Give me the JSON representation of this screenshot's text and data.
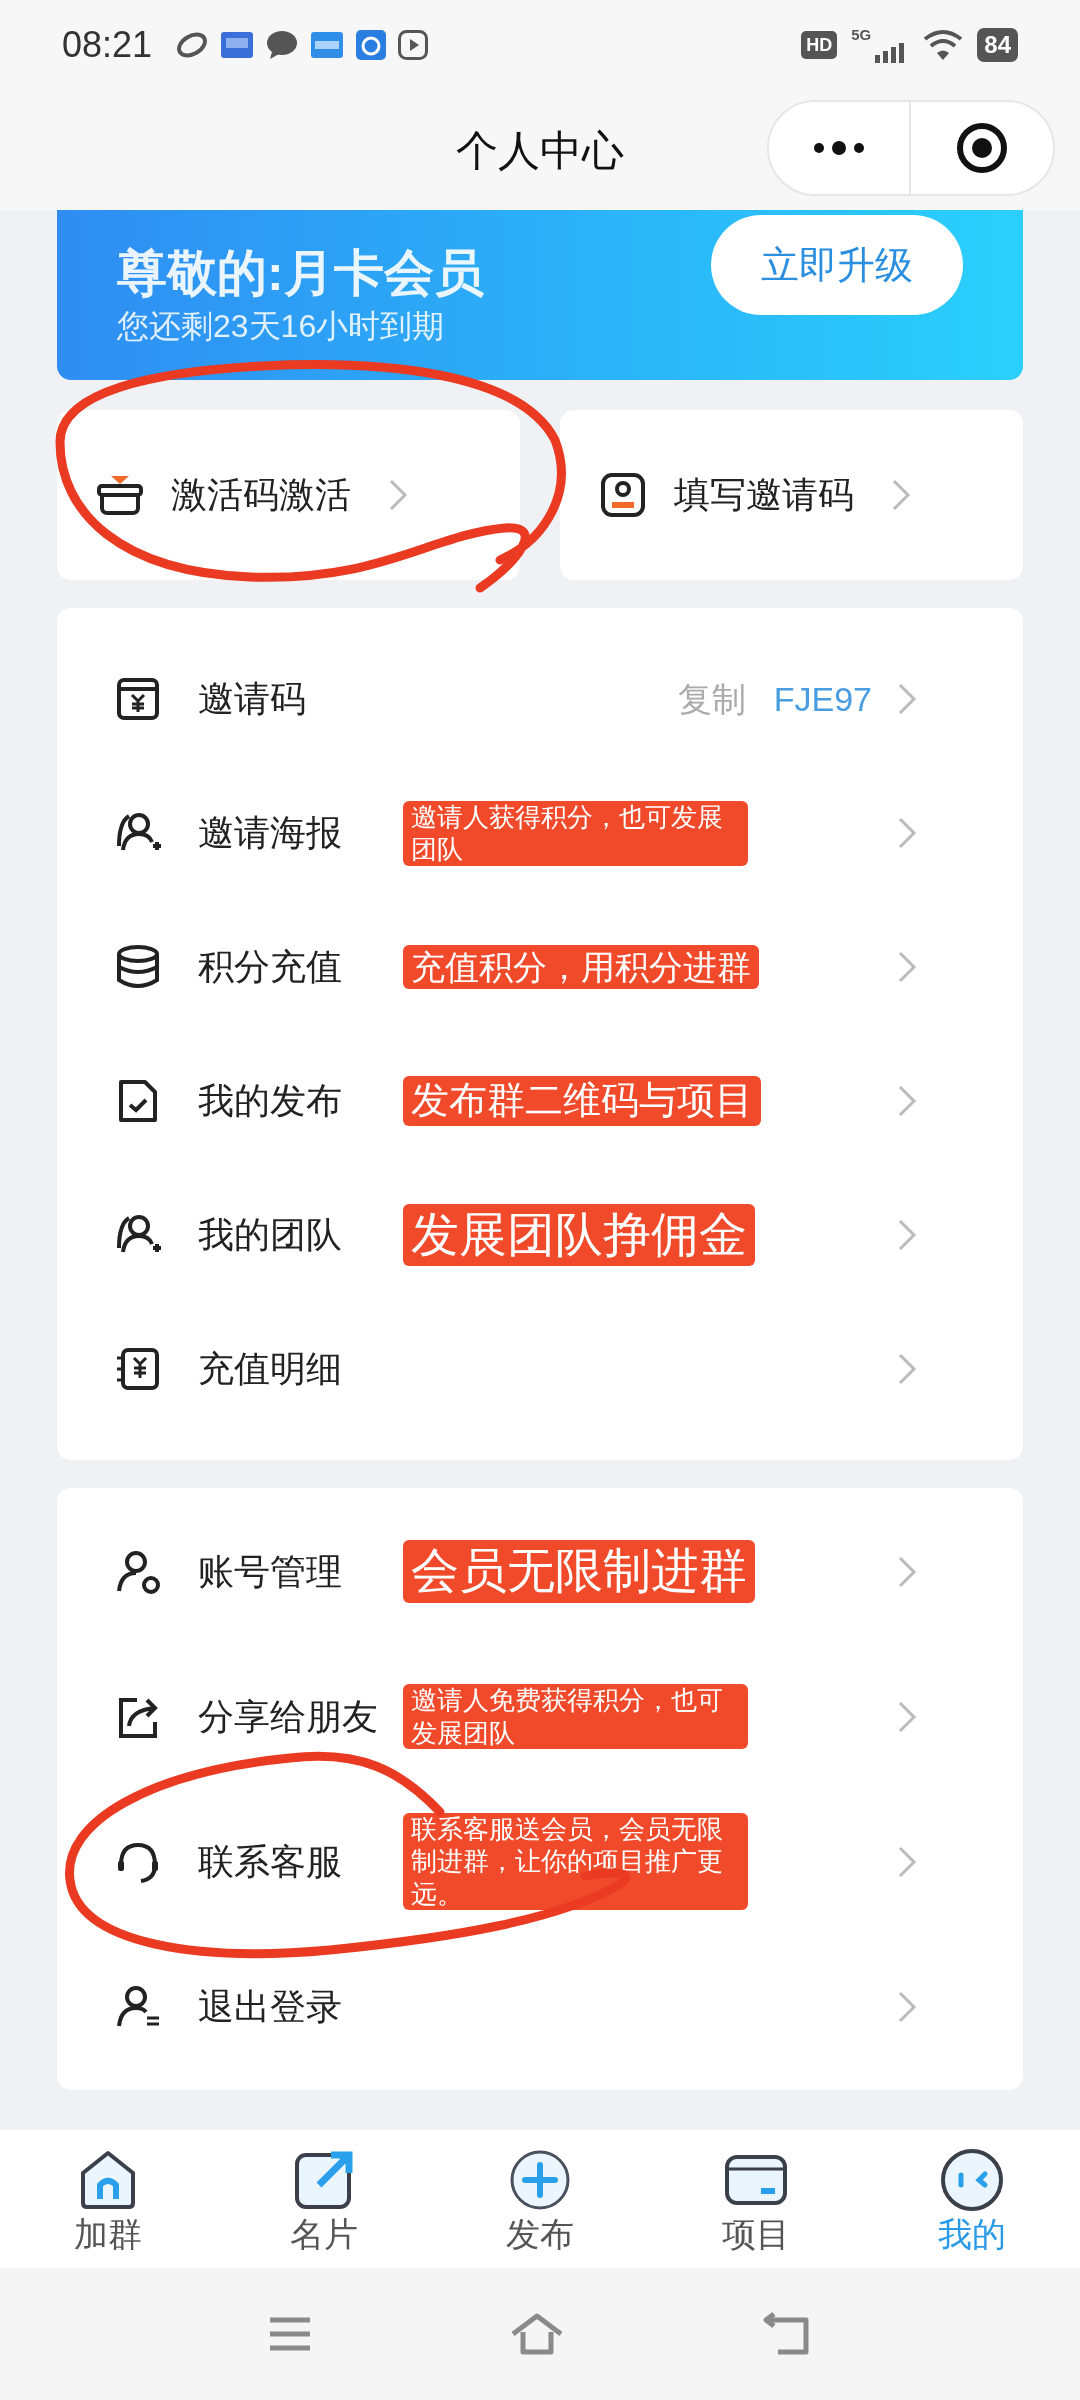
{
  "status_bar": {
    "time": "08:21",
    "hd": "HD",
    "network": "5G",
    "battery": "84"
  },
  "header": {
    "title": "个人中心"
  },
  "banner": {
    "title": "尊敬的:月卡会员",
    "subtitle": "您还剩23天16小时到期",
    "button": "立即升级"
  },
  "quick_actions": [
    {
      "label": "激活码激活"
    },
    {
      "label": "填写邀请码"
    }
  ],
  "menu_groups": [
    {
      "items": [
        {
          "label": "邀请码",
          "action": "复制",
          "code": "FJE97"
        },
        {
          "label": "邀请海报",
          "note": "邀请人获得积分，也可发展团队"
        },
        {
          "label": "积分充值",
          "note": "充值积分，用积分进群"
        },
        {
          "label": "我的发布",
          "note": "发布群二维码与项目"
        },
        {
          "label": "我的团队",
          "note": "发展团队挣佣金"
        },
        {
          "label": "充值明细"
        }
      ]
    },
    {
      "items": [
        {
          "label": "账号管理",
          "note": "会员无限制进群"
        },
        {
          "label": "分享给朋友",
          "note": "邀请人免费获得积分，也可发展团队"
        },
        {
          "label": "联系客服",
          "note": "联系客服送会员，会员无限制进群，让你的项目推广更远。"
        },
        {
          "label": "退出登录"
        }
      ]
    }
  ],
  "tab_bar": [
    {
      "label": "加群",
      "selected": false
    },
    {
      "label": "名片",
      "selected": false
    },
    {
      "label": "发布",
      "selected": false
    },
    {
      "label": "项目",
      "selected": false
    },
    {
      "label": "我的",
      "selected": true
    }
  ]
}
